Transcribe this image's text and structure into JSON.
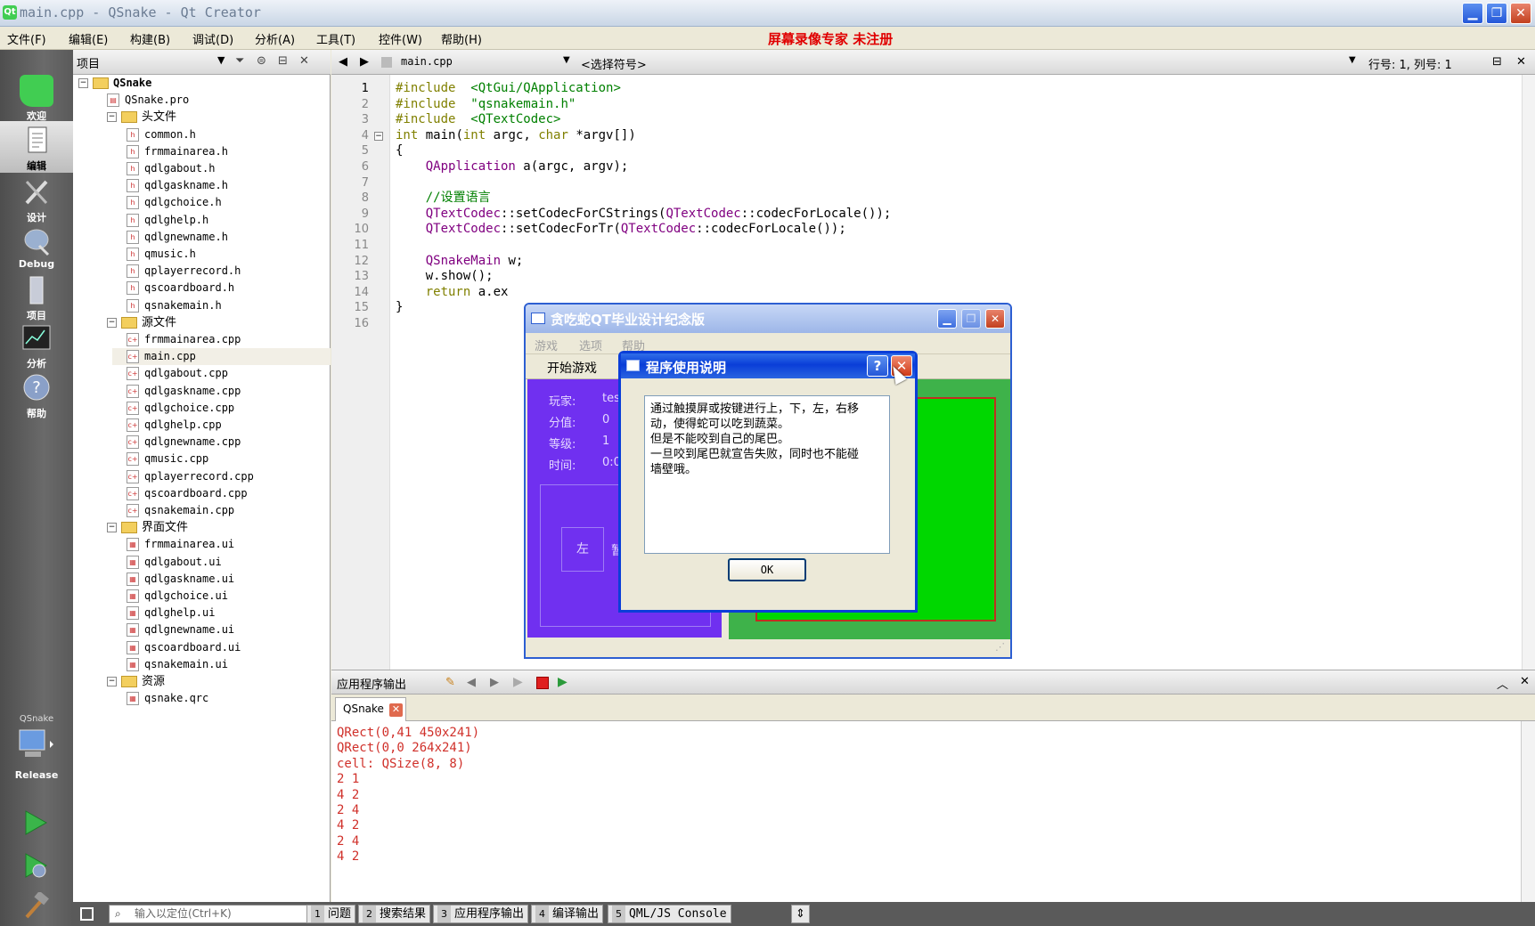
{
  "window": {
    "title": "main.cpp - QSnake - Qt Creator",
    "qt_icon": "Qt",
    "min_glyph": "▁",
    "max_glyph": "❐",
    "close_glyph": "✕"
  },
  "menubar": {
    "items": [
      "文件(F)",
      "编辑(E)",
      "构建(B)",
      "调试(D)",
      "分析(A)",
      "工具(T)",
      "控件(W)",
      "帮助(H)"
    ],
    "promo": "屏幕录像专家  未注册"
  },
  "modes": [
    {
      "label": "欢迎",
      "icon": "qt-logo-icon"
    },
    {
      "label": "编辑",
      "icon": "edit-document-icon"
    },
    {
      "label": "设计",
      "icon": "design-icon"
    },
    {
      "label": "Debug",
      "icon": "debug-icon"
    },
    {
      "label": "项目",
      "icon": "project-icon"
    },
    {
      "label": "分析",
      "icon": "analyze-icon"
    },
    {
      "label": "帮助",
      "icon": "help-icon"
    }
  ],
  "run_target": {
    "project": "QSnake",
    "config": "Release"
  },
  "project_pane": {
    "title": "项目",
    "tree": [
      {
        "level": 0,
        "kind": "project",
        "label": "QSnake",
        "expanded": true
      },
      {
        "level": 1,
        "kind": "pro",
        "label": "QSnake.pro"
      },
      {
        "level": 1,
        "kind": "folder",
        "label": "头文件",
        "expanded": true
      },
      {
        "level": 2,
        "kind": "h",
        "label": "common.h"
      },
      {
        "level": 2,
        "kind": "h",
        "label": "frmmainarea.h"
      },
      {
        "level": 2,
        "kind": "h",
        "label": "qdlgabout.h"
      },
      {
        "level": 2,
        "kind": "h",
        "label": "qdlgaskname.h"
      },
      {
        "level": 2,
        "kind": "h",
        "label": "qdlgchoice.h"
      },
      {
        "level": 2,
        "kind": "h",
        "label": "qdlghelp.h"
      },
      {
        "level": 2,
        "kind": "h",
        "label": "qdlgnewname.h"
      },
      {
        "level": 2,
        "kind": "h",
        "label": "qmusic.h"
      },
      {
        "level": 2,
        "kind": "h",
        "label": "qplayerrecord.h"
      },
      {
        "level": 2,
        "kind": "h",
        "label": "qscoardboard.h"
      },
      {
        "level": 2,
        "kind": "h",
        "label": "qsnakemain.h"
      },
      {
        "level": 1,
        "kind": "folder",
        "label": "源文件",
        "expanded": true
      },
      {
        "level": 2,
        "kind": "cpp",
        "label": "frmmainarea.cpp"
      },
      {
        "level": 2,
        "kind": "cpp",
        "label": "main.cpp",
        "selected": true
      },
      {
        "level": 2,
        "kind": "cpp",
        "label": "qdlgabout.cpp"
      },
      {
        "level": 2,
        "kind": "cpp",
        "label": "qdlgaskname.cpp"
      },
      {
        "level": 2,
        "kind": "cpp",
        "label": "qdlgchoice.cpp"
      },
      {
        "level": 2,
        "kind": "cpp",
        "label": "qdlghelp.cpp"
      },
      {
        "level": 2,
        "kind": "cpp",
        "label": "qdlgnewname.cpp"
      },
      {
        "level": 2,
        "kind": "cpp",
        "label": "qmusic.cpp"
      },
      {
        "level": 2,
        "kind": "cpp",
        "label": "qplayerrecord.cpp"
      },
      {
        "level": 2,
        "kind": "cpp",
        "label": "qscoardboard.cpp"
      },
      {
        "level": 2,
        "kind": "cpp",
        "label": "qsnakemain.cpp"
      },
      {
        "level": 1,
        "kind": "folder",
        "label": "界面文件",
        "expanded": true
      },
      {
        "level": 2,
        "kind": "ui",
        "label": "frmmainarea.ui"
      },
      {
        "level": 2,
        "kind": "ui",
        "label": "qdlgabout.ui"
      },
      {
        "level": 2,
        "kind": "ui",
        "label": "qdlgaskname.ui"
      },
      {
        "level": 2,
        "kind": "ui",
        "label": "qdlgchoice.ui"
      },
      {
        "level": 2,
        "kind": "ui",
        "label": "qdlghelp.ui"
      },
      {
        "level": 2,
        "kind": "ui",
        "label": "qdlgnewname.ui"
      },
      {
        "level": 2,
        "kind": "ui",
        "label": "qscoardboard.ui"
      },
      {
        "level": 2,
        "kind": "ui",
        "label": "qsnakemain.ui"
      },
      {
        "level": 1,
        "kind": "folder",
        "label": "资源",
        "expanded": true
      },
      {
        "level": 2,
        "kind": "qrc",
        "label": "qsnake.qrc"
      }
    ]
  },
  "editor": {
    "file": "main.cpp",
    "symbol": "<选择符号>",
    "position": "行号: 1, 列号: 1",
    "lines": [
      [
        [
          "kw",
          "#include"
        ],
        [
          "",
          "  "
        ],
        [
          "str",
          "<QtGui/QApplication>"
        ]
      ],
      [
        [
          "kw",
          "#include"
        ],
        [
          "",
          "  "
        ],
        [
          "str",
          "\"qsnakemain.h\""
        ]
      ],
      [
        [
          "kw",
          "#include"
        ],
        [
          "",
          "  "
        ],
        [
          "str",
          "<QTextCodec>"
        ]
      ],
      [
        [
          "kw",
          "int"
        ],
        [
          "",
          " main("
        ],
        [
          "kw",
          "int"
        ],
        [
          "",
          " argc, "
        ],
        [
          "kw",
          "char"
        ],
        [
          "",
          " *argv[])"
        ]
      ],
      [
        [
          "",
          "{"
        ]
      ],
      [
        [
          "",
          "    "
        ],
        [
          "typ",
          "QApplication"
        ],
        [
          "",
          " a(argc, argv);"
        ]
      ],
      [
        [
          "",
          ""
        ]
      ],
      [
        [
          "",
          "    "
        ],
        [
          "cm",
          "//设置语言"
        ]
      ],
      [
        [
          "",
          "    "
        ],
        [
          "typ",
          "QTextCodec"
        ],
        [
          "",
          "::setCodecForCStrings("
        ],
        [
          "typ",
          "QTextCodec"
        ],
        [
          "",
          "::codecForLocale());"
        ]
      ],
      [
        [
          "",
          "    "
        ],
        [
          "typ",
          "QTextCodec"
        ],
        [
          "",
          "::setCodecForTr("
        ],
        [
          "typ",
          "QTextCodec"
        ],
        [
          "",
          "::codecForLocale());"
        ]
      ],
      [
        [
          "",
          ""
        ]
      ],
      [
        [
          "",
          "    "
        ],
        [
          "typ",
          "QSnakeMain"
        ],
        [
          "",
          " w;"
        ]
      ],
      [
        [
          "",
          "    w.show();"
        ]
      ],
      [
        [
          "",
          "    "
        ],
        [
          "kw",
          "return"
        ],
        [
          "",
          " a.ex"
        ]
      ],
      [
        [
          "",
          "}"
        ]
      ],
      [
        [
          "",
          ""
        ]
      ]
    ]
  },
  "output": {
    "title": "应用程序输出",
    "tab": "QSnake",
    "lines": [
      "QRect(0,41 450x241)",
      "QRect(0,0 264x241)",
      "cell: QSize(8, 8)",
      "2 1",
      "4 2",
      "2 4",
      "4 2",
      "2 4",
      "4 2"
    ]
  },
  "statusbar": {
    "locator_placeholder": "输入以定位(Ctrl+K)",
    "panes": [
      {
        "num": "1",
        "label": "问题"
      },
      {
        "num": "2",
        "label": "搜索结果"
      },
      {
        "num": "3",
        "label": "应用程序输出"
      },
      {
        "num": "4",
        "label": "编译输出"
      },
      {
        "num": "5",
        "label": "QML/JS Console"
      }
    ]
  },
  "game": {
    "title": "贪吃蛇QT毕业设计纪念版",
    "menu": [
      "游戏",
      "选项",
      "帮助"
    ],
    "toolbar_action": "开始游戏",
    "stats": [
      {
        "label": "玩家:",
        "value": "tes"
      },
      {
        "label": "分值:",
        "value": "0"
      },
      {
        "label": "等级:",
        "value": "1"
      },
      {
        "label": "时间:",
        "value": "0:0"
      }
    ],
    "left_button": "左",
    "pause_button_partial": "暂"
  },
  "help_dialog": {
    "title": "程序使用说明",
    "help_glyph": "?",
    "close_glyph": "✕",
    "message_lines": [
      "通过触摸屏或按键进行上，下，左，右移",
      "动，使得蛇可以吃到蔬菜。",
      "但是不能咬到自己的尾巴。",
      "一旦咬到尾巴就宣告失败，同时也不能碰",
      "墙壁哦。"
    ],
    "ok_label": "OK"
  }
}
